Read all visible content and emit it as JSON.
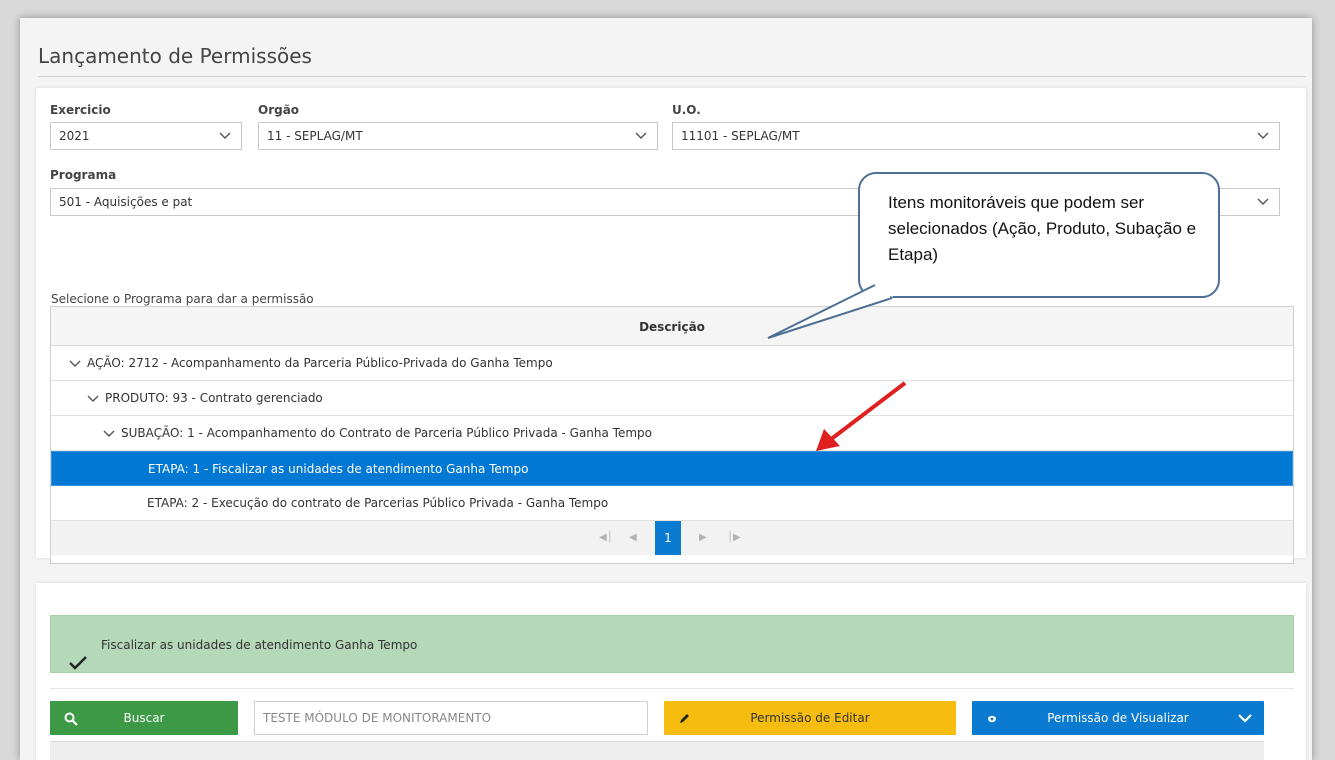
{
  "page": {
    "title": "Lançamento de Permissões"
  },
  "filters": {
    "exercicio": {
      "label": "Exercicio",
      "value": "2021"
    },
    "orgao": {
      "label": "Orgão",
      "value": "11 - SEPLAG/MT"
    },
    "uo": {
      "label": "U.O.",
      "value": "11101 - SEPLAG/MT"
    },
    "programa": {
      "label": "Programa",
      "value": "501 - Aquisições e pat"
    }
  },
  "grid": {
    "hint": "Selecione o Programa para dar a permissão",
    "header": "Descrição",
    "rows": [
      {
        "text": "AÇÃO: 2712 - Acompanhamento da Parceria Público-Privada do Ganha Tempo",
        "level": 0,
        "expandable": true,
        "selected": false
      },
      {
        "text": "PRODUTO: 93 - Contrato gerenciado",
        "level": 1,
        "expandable": true,
        "selected": false
      },
      {
        "text": "SUBAÇÃO: 1 - Acompanhamento do Contrato de Parceria Público Privada - Ganha Tempo",
        "level": 2,
        "expandable": true,
        "selected": false
      },
      {
        "text": "ETAPA: 1 - Fiscalizar as unidades de atendimento Ganha Tempo",
        "level": 3,
        "expandable": false,
        "selected": true
      },
      {
        "text": "ETAPA: 2 - Execução do contrato de Parcerias Público Privada - Ganha Tempo",
        "level": 3,
        "expandable": false,
        "selected": false
      }
    ],
    "pager": {
      "current_page": "1"
    }
  },
  "selection": {
    "message": "Fiscalizar as unidades de atendimento Ganha Tempo"
  },
  "actions": {
    "search_label": "Buscar",
    "search_value": "TESTE MÓDULO DE MONITORAMENTO",
    "edit_label": "Permissão de Editar",
    "view_label": "Permissão de Visualizar"
  },
  "annotation": {
    "callout_text": "Itens monitoráveis que podem ser selecionados (Ação, Produto, Subação e Etapa)"
  },
  "colors": {
    "selected_row": "#0078d4",
    "search_button": "#3c9a47",
    "edit_button": "#f6bd10",
    "view_button": "#0b7ad1",
    "success_banner": "#b5d8b8",
    "arrow": "#e02020"
  }
}
